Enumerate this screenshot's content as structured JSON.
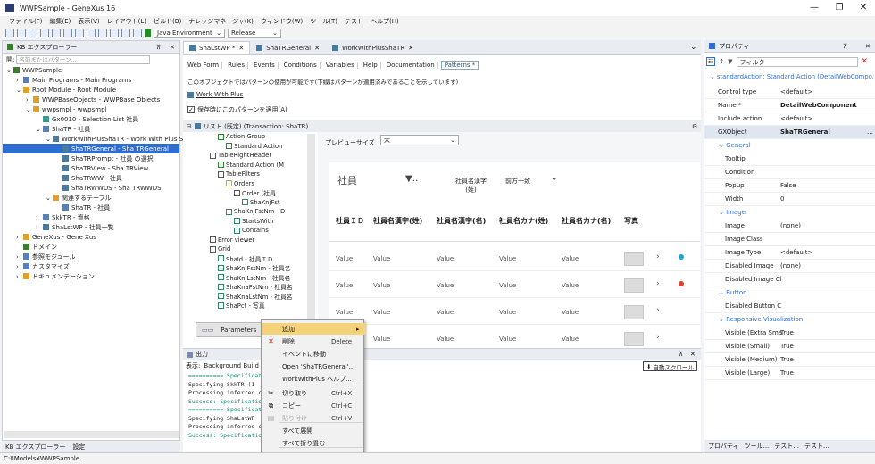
{
  "window": {
    "title": "WWPSample - GeneXus 16",
    "min": "—",
    "max": "❐",
    "close": "✕"
  },
  "menu": [
    "ファイル(F)",
    "編集(E)",
    "表示(V)",
    "レイアウト(L)",
    "ビルド(B)",
    "ナレッジマネージャ(K)",
    "ウィンドウ(W)",
    "ツール(T)",
    "テスト",
    "ヘルプ(H)"
  ],
  "toolbar": {
    "environment": "Java Environment",
    "config": "Release"
  },
  "kb": {
    "title": "KB エクスプローラー",
    "pin": "⊼",
    "close": "✕",
    "search_label": "開:",
    "search_placeholder": "名前またはパターン...",
    "tree": [
      {
        "label": "WWPSample",
        "indent": 0,
        "exp": "⌄",
        "color": "#3a7d2f"
      },
      {
        "label": "Main Programs - Main Programs",
        "indent": 1,
        "exp": "›",
        "color": "#5a7fb5"
      },
      {
        "label": "Root Module - Root Module",
        "indent": 1,
        "exp": "⌄",
        "color": "#e0a030"
      },
      {
        "label": "WWPBaseObjects - WWPBase Objects",
        "indent": 2,
        "exp": "›",
        "color": "#e0a030"
      },
      {
        "label": "wwpsmpl - wwpsmpl",
        "indent": 2,
        "exp": "⌄",
        "color": "#e0a030"
      },
      {
        "label": "Gx0010 - Selection List 社員",
        "indent": 3,
        "exp": "",
        "color": "#3a9a8a"
      },
      {
        "label": "ShaTR - 社員",
        "indent": 3,
        "exp": "⌄",
        "color": "#5a7fb5"
      },
      {
        "label": "WorkWithPlusShaTR - Work With Plus S",
        "indent": 4,
        "exp": "⌄",
        "color": "#4a7aa0"
      },
      {
        "label": "ShaTRGeneral - Sha TRGeneral",
        "indent": 5,
        "exp": "",
        "color": "#4a7aa0",
        "selected": true
      },
      {
        "label": "ShaTRPrompt - 社員 の選択",
        "indent": 5,
        "exp": "",
        "color": "#4a7aa0"
      },
      {
        "label": "ShaTRView - Sha TRView",
        "indent": 5,
        "exp": "",
        "color": "#4a7aa0"
      },
      {
        "label": "ShaTRWW - 社員",
        "indent": 5,
        "exp": "",
        "color": "#4a7aa0"
      },
      {
        "label": "ShaTRWWDS - Sha TRWWDS",
        "indent": 5,
        "exp": "",
        "color": "#4a7aa0"
      },
      {
        "label": "関連するテーブル",
        "indent": 4,
        "exp": "⌄",
        "color": "#e0a030"
      },
      {
        "label": "ShaTR - 社員",
        "indent": 5,
        "exp": "",
        "color": "#5a7fb5"
      },
      {
        "label": "SkkTR - 資格",
        "indent": 3,
        "exp": "›",
        "color": "#5a7fb5"
      },
      {
        "label": "ShaLstWP - 社員一覧",
        "indent": 3,
        "exp": "›",
        "color": "#4a7aa0"
      },
      {
        "label": "GeneXus - Gene Xus",
        "indent": 1,
        "exp": "›",
        "color": "#e0a030"
      },
      {
        "label": "ドメイン",
        "indent": 1,
        "exp": "",
        "color": "#3a7d2f"
      },
      {
        "label": "参照モジュール",
        "indent": 1,
        "exp": "›",
        "color": "#5a7fb5"
      },
      {
        "label": "カスタマイズ",
        "indent": 1,
        "exp": "›",
        "color": "#5a7fb5"
      },
      {
        "label": "ドキュメンテーション",
        "indent": 1,
        "exp": "›",
        "color": "#e0a030"
      }
    ],
    "bottom_tabs": [
      "KB エクスプローラー",
      "設定"
    ]
  },
  "doc_tabs": [
    {
      "label": "ShaLstWP *",
      "active": true
    },
    {
      "label": "ShaTRGeneral",
      "active": false
    },
    {
      "label": "WorkWithPlusShaTR",
      "active": false
    }
  ],
  "sub_tabs": [
    "Web Form",
    "Rules",
    "Events",
    "Conditions",
    "Variables",
    "Help",
    "Documentation",
    "Patterns *"
  ],
  "info_message": "このオブジェクトではパターンの使用が可能です(下線はパターンが適用済みであることを示しています)",
  "work_with_plus_link": "Work With Plus",
  "apply_on_save": "保存時にこのパターンを適用(A)",
  "pattern_header": "リスト (既定) (Transaction: ShaTR)",
  "pattern_tree": [
    {
      "label": "Action Group",
      "indent": 2,
      "color": "#2a8a2a"
    },
    {
      "label": "Standard Action",
      "indent": 3,
      "color": "#2a8a2a"
    },
    {
      "label": "TableRightHeader",
      "indent": 1,
      "color": "#555"
    },
    {
      "label": "Standard Action (M",
      "indent": 2,
      "color": "#2a8a2a"
    },
    {
      "label": "TableFilters",
      "indent": 2,
      "color": "#555"
    },
    {
      "label": "Orders",
      "indent": 3,
      "color": "#e0a030"
    },
    {
      "label": "Order (社員",
      "indent": 4,
      "color": "#555"
    },
    {
      "label": "ShaKnjFst",
      "indent": 5,
      "color": "#2a8a6a"
    },
    {
      "label": "ShaKnjFstNm - D",
      "indent": 3,
      "color": "#2a8a6a"
    },
    {
      "label": "StartsWith",
      "indent": 4,
      "color": "#2a8a6a"
    },
    {
      "label": "Contains",
      "indent": 4,
      "color": "#2a8a6a"
    },
    {
      "label": "Error viewer",
      "indent": 1,
      "color": "#555"
    },
    {
      "label": "Grid",
      "indent": 1,
      "color": "#555"
    },
    {
      "label": "ShaId - 社員ＩＤ",
      "indent": 2,
      "color": "#2a8a6a"
    },
    {
      "label": "ShaKnjFstNm - 社員名",
      "indent": 2,
      "color": "#2a8a6a"
    },
    {
      "label": "ShaKnjLstNm - 社員名",
      "indent": 2,
      "color": "#2a8a6a"
    },
    {
      "label": "ShaKnaFstNm - 社員名",
      "indent": 2,
      "color": "#2a8a6a"
    },
    {
      "label": "ShaKnaLstNm - 社員名",
      "indent": 2,
      "color": "#2a8a6a"
    },
    {
      "label": "ShaPct - 写真",
      "indent": 2,
      "color": "#2a8a6a"
    }
  ],
  "preview": {
    "size_label": "プレビューサイズ",
    "size_value": "大",
    "title": "社員",
    "filter_field": "社員名漢字(姓)",
    "filter_mode": "前方一致",
    "columns": [
      "社員ＩＤ",
      "社員名漢字(姓)",
      "社員名漢字(名)",
      "社員名カナ(姓)",
      "社員名カナ(名)",
      "写真"
    ],
    "cell": "Value",
    "rows": 4
  },
  "params_label": "Parameters",
  "context_menu": [
    {
      "label": "追加",
      "shortcut": "",
      "icon": "",
      "arrow": "▸",
      "hl": true
    },
    {
      "label": "削除",
      "shortcut": "Delete",
      "icon": "✕",
      "color": "#d02020"
    },
    {
      "label": "イベントに移動",
      "shortcut": "",
      "icon": ""
    },
    {
      "label": "Open 'ShaTRGeneral'...",
      "shortcut": "",
      "icon": ""
    },
    {
      "label": "WorkWithPlus ヘルプ...",
      "shortcut": "",
      "icon": ""
    },
    {
      "label": "切り取り",
      "shortcut": "Ctrl+X",
      "icon": "✂"
    },
    {
      "label": "コピー",
      "shortcut": "Ctrl+C",
      "icon": "⧉"
    },
    {
      "label": "貼り付け",
      "shortcut": "Ctrl+V",
      "icon": "▤",
      "disabled": true
    },
    {
      "label": "すべて展開",
      "shortcut": "",
      "icon": ""
    },
    {
      "label": "すべて折り畳む",
      "shortcut": "",
      "icon": ""
    },
    {
      "label": "プロパティ(P)",
      "shortcut": "F4",
      "icon": "▣"
    }
  ],
  "output": {
    "title": "出力",
    "show_label": "表示:",
    "show_value": "Background Build",
    "autoscroll": "自動スクロール",
    "lines": [
      {
        "t": "========== Specificat",
        "s": true
      },
      {
        "t": "Specifying SkkTR (1",
        "s": false
      },
      {
        "t": "Processing inferred c",
        "s": false
      },
      {
        "t": "Success: Specificatio",
        "s": true
      },
      {
        "t": "========== Specificat",
        "s": true
      },
      {
        "t": "Specifying ShaLstWP",
        "s": false
      },
      {
        "t": "Processing inferred c",
        "s": false
      },
      {
        "t": "Success: Specificatio",
        "s": true
      }
    ]
  },
  "properties": {
    "title": "プロパティ",
    "filter_label": "フィルタ",
    "header": "standardAction: Standard Action (DetailWebCompo...",
    "rows": [
      {
        "k": "Control type",
        "v": "<default>"
      },
      {
        "k": "Name *",
        "v": "DetailWebComponent",
        "b": true
      },
      {
        "k": "Include action",
        "v": "<default>"
      },
      {
        "k": "GXObject",
        "v": "ShaTRGeneral",
        "b": true,
        "hl": true
      },
      {
        "cat": "General"
      },
      {
        "k": "Tooltip",
        "v": "",
        "ind": true
      },
      {
        "k": "Condition",
        "v": "",
        "ind": true
      },
      {
        "k": "Popup",
        "v": "False",
        "ind": true
      },
      {
        "k": "Width",
        "v": "0",
        "ind": true
      },
      {
        "cat": "Image"
      },
      {
        "k": "Image",
        "v": "(none)",
        "ind": true
      },
      {
        "k": "Image Class",
        "v": "",
        "ind": true
      },
      {
        "k": "Image Type",
        "v": "<default>",
        "ind": true
      },
      {
        "k": "Disabled Image",
        "v": "(none)",
        "ind": true
      },
      {
        "k": "Disabled Image Cl",
        "v": "",
        "ind": true
      },
      {
        "cat": "Button"
      },
      {
        "k": "Disabled Button C",
        "v": "",
        "ind": true
      },
      {
        "cat": "Responsive Visualization"
      },
      {
        "k": "Visible (Extra Sma",
        "v": "True",
        "ind": true
      },
      {
        "k": "Visible (Small)",
        "v": "True",
        "ind": true
      },
      {
        "k": "Visible (Medium)",
        "v": "True",
        "ind": true
      },
      {
        "k": "Visible (Large)",
        "v": "True",
        "ind": true
      }
    ],
    "bottom_tabs": [
      "プロパティ",
      "ツール...",
      "テスト...",
      "テスト..."
    ]
  },
  "status": "C:¥Models¥WWPSample"
}
